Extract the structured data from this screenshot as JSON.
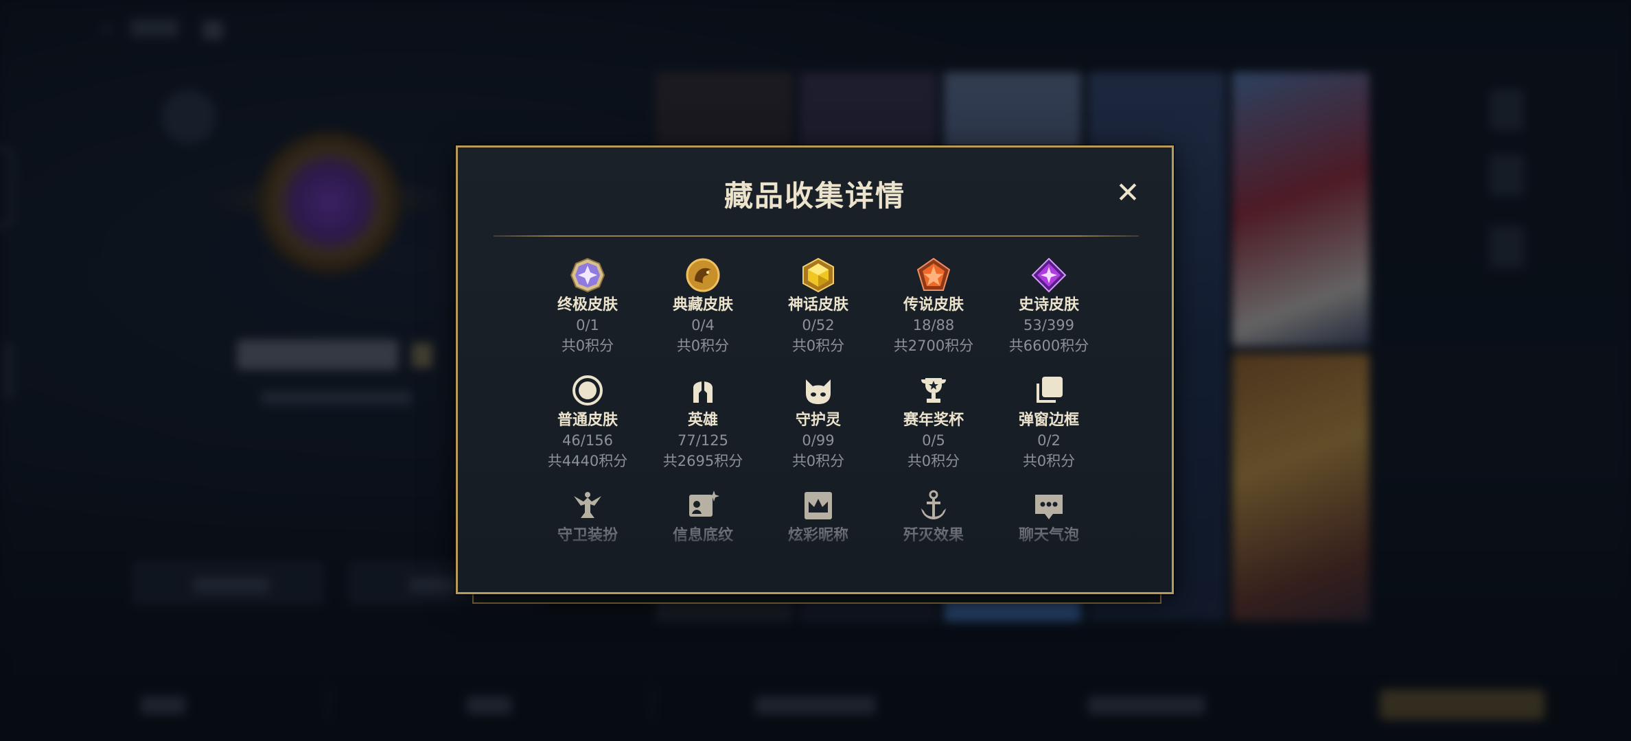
{
  "modal": {
    "title": "藏品收集详情",
    "close_icon": "close-icon",
    "rows": [
      [
        {
          "name": "终极皮肤",
          "count": "0/1",
          "points": "共0积分",
          "icon": "ultimate-skin-gem-icon"
        },
        {
          "name": "典藏皮肤",
          "count": "0/4",
          "points": "共0积分",
          "icon": "collection-skin-dragon-icon"
        },
        {
          "name": "神话皮肤",
          "count": "0/52",
          "points": "共0积分",
          "icon": "mythic-skin-gem-icon"
        },
        {
          "name": "传说皮肤",
          "count": "18/88",
          "points": "共2700积分",
          "icon": "legendary-skin-gem-icon"
        },
        {
          "name": "史诗皮肤",
          "count": "53/399",
          "points": "共6600积分",
          "icon": "epic-skin-gem-icon"
        }
      ],
      [
        {
          "name": "普通皮肤",
          "count": "46/156",
          "points": "共4440积分",
          "icon": "normal-skin-ring-icon"
        },
        {
          "name": "英雄",
          "count": "77/125",
          "points": "共2695积分",
          "icon": "hero-helmet-icon"
        },
        {
          "name": "守护灵",
          "count": "0/99",
          "points": "共0积分",
          "icon": "guardian-spirit-icon"
        },
        {
          "name": "赛年奖杯",
          "count": "0/5",
          "points": "共0积分",
          "icon": "season-trophy-icon"
        },
        {
          "name": "弹窗边框",
          "count": "0/2",
          "points": "共0积分",
          "icon": "popup-frame-icon"
        }
      ],
      [
        {
          "name": "守卫装扮",
          "icon": "guard-costume-icon"
        },
        {
          "name": "信息底纹",
          "icon": "info-background-icon"
        },
        {
          "name": "炫彩昵称",
          "icon": "colorful-nickname-icon"
        },
        {
          "name": "歼灭效果",
          "icon": "annihilation-effect-icon"
        },
        {
          "name": "聊天气泡",
          "icon": "chat-bubble-icon"
        }
      ]
    ]
  },
  "colors": {
    "gold_border": "#b89a5a",
    "title_text": "#ece3cd",
    "muted_text": "#8d929a",
    "modal_bg": "#1b2129"
  }
}
